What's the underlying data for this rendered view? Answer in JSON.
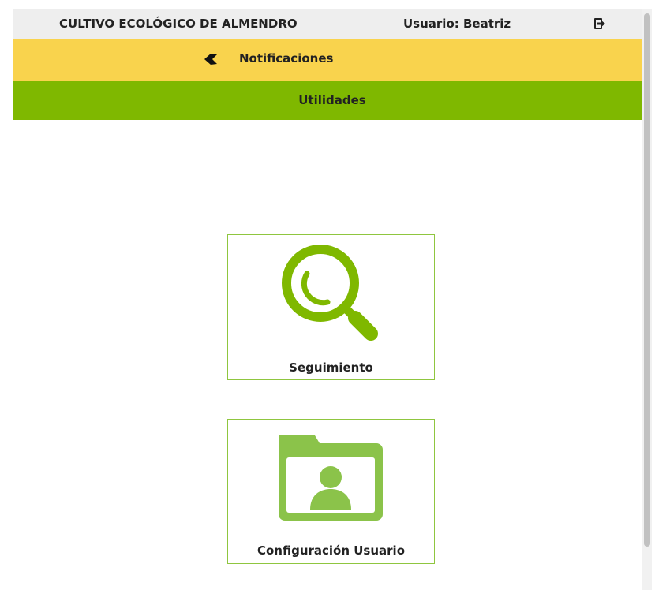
{
  "header": {
    "app_title": "CULTIVO ECOLÓGICO DE ALMENDRO",
    "user_label": "Usuario: Beatriz",
    "logout_icon": "logout-icon"
  },
  "notifications_bar": {
    "label": "Notificaciones",
    "icon": "back-arrow-icon",
    "color": "#f9d34d"
  },
  "section": {
    "title": "Utilidades",
    "color": "#7fb800"
  },
  "tiles": [
    {
      "label": "Seguimiento",
      "icon": "magnifier-icon",
      "color": "#7fb800"
    },
    {
      "label": "Configuración Usuario",
      "icon": "user-folder-icon",
      "color": "#8bc34a"
    }
  ]
}
